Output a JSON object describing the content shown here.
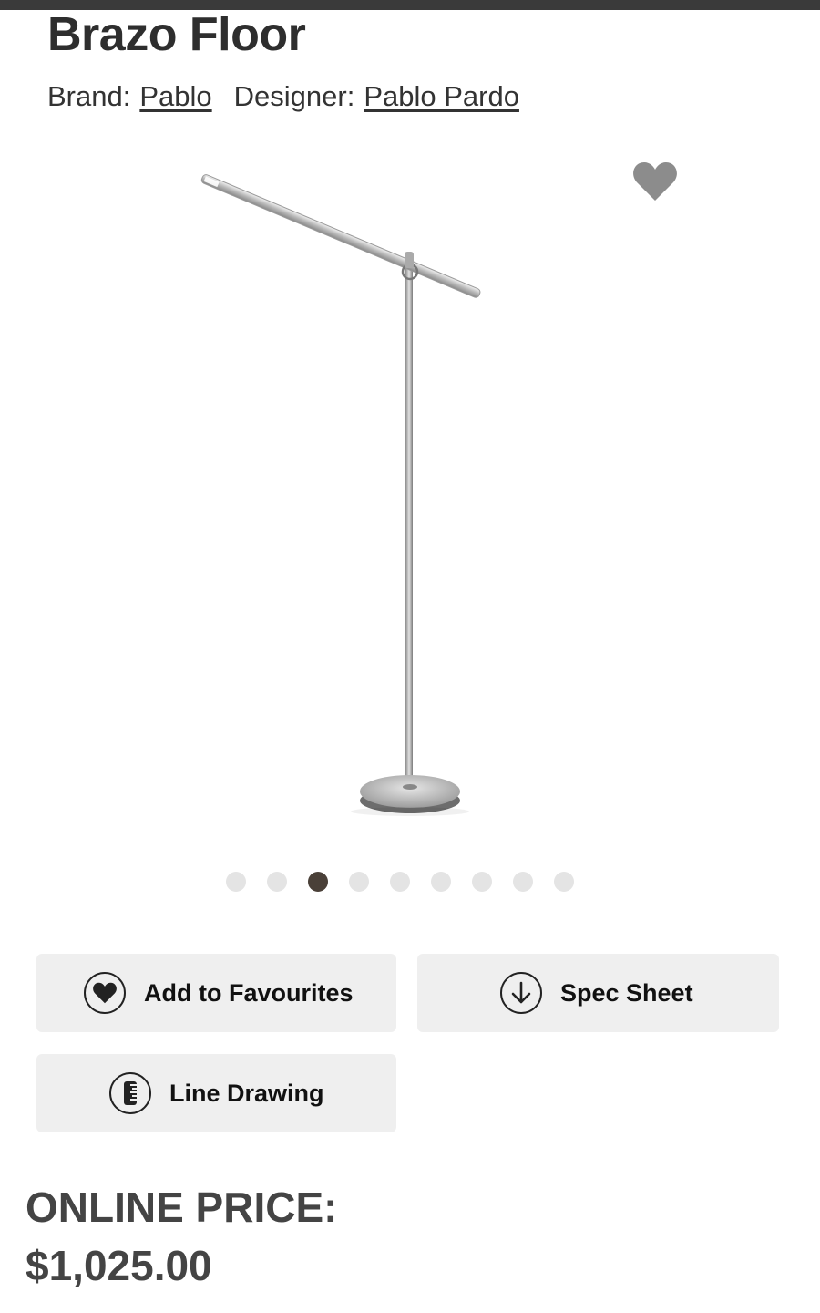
{
  "product": {
    "title": "Brazo Floor",
    "brand_label": "Brand:",
    "brand_name": "Pablo",
    "designer_label": "Designer:",
    "designer_name": "Pablo Pardo"
  },
  "gallery": {
    "image_alt": "Brazo Floor lamp",
    "favourite_icon": "heart-icon",
    "dots_count": 9,
    "active_dot": 3
  },
  "actions": {
    "add_to_favourites": "Add to Favourites",
    "spec_sheet": "Spec Sheet",
    "line_drawing": "Line Drawing"
  },
  "pricing": {
    "label": "ONLINE PRICE:",
    "value": "$1,025.00"
  },
  "colors": {
    "topbar": "#3a3a3a",
    "button_bg": "#efefef",
    "dot_inactive": "#e4e4e4",
    "dot_active": "#4a4038",
    "heart": "#8c8c8c"
  }
}
